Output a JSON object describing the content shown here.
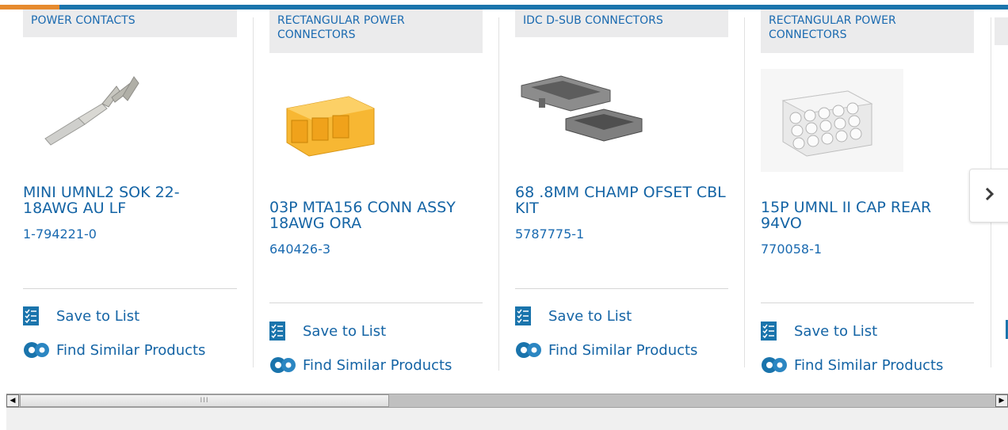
{
  "carousel": {
    "cards": [
      {
        "category": "POWER CONTACTS",
        "title": "MINI UMNL2 SOK 22-18AWG AU LF",
        "part_number": "1-794221-0",
        "save_label": "Save to List",
        "similar_label": "Find Similar Products"
      },
      {
        "category": "RECTANGULAR POWER CONNECTORS",
        "title": "03P MTA156 CONN ASSY 18AWG ORA",
        "part_number": "640426-3",
        "save_label": "Save to List",
        "similar_label": "Find Similar Products"
      },
      {
        "category": "IDC D-SUB CONNECTORS",
        "title": "68 .8MM CHAMP OFSET CBL KIT",
        "part_number": "5787775-1",
        "save_label": "Save to List",
        "similar_label": "Find Similar Products"
      },
      {
        "category": "RECTANGULAR POWER CONNECTORS",
        "title": "15P UMNL II CAP REAR 94VO",
        "part_number": "770058-1",
        "save_label": "Save to List",
        "similar_label": "Find Similar Products"
      }
    ],
    "next_icon": "chevron-right-icon"
  },
  "scrollbar": {
    "left_arrow": "◀",
    "right_arrow": "▶",
    "grip": "III"
  },
  "colors": {
    "accent_bar": "#1a74ac",
    "accent_orange": "#e68a2e",
    "link_blue": "#1464a5",
    "category_bg": "#ebebec"
  }
}
